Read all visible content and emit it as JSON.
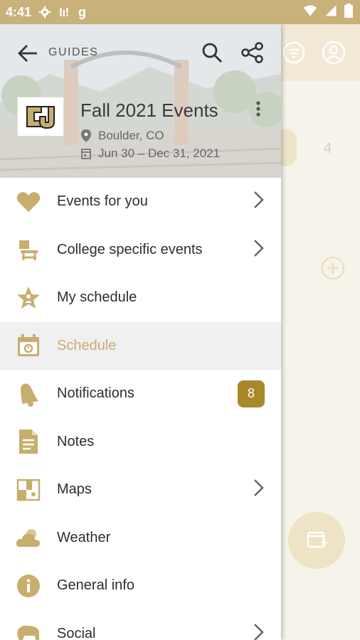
{
  "status_bar": {
    "time": "4:41",
    "g_label": "g"
  },
  "drawer": {
    "nav_label": "GUIDES",
    "guide_title": "Fall 2021 Events",
    "location": "Boulder, CO",
    "dates": "Jun 30 – Dec 31, 2021"
  },
  "menu": {
    "items": [
      {
        "label": "Events for you",
        "icon": "heart-icon",
        "chevron": true
      },
      {
        "label": "College specific events",
        "icon": "school-desk-icon",
        "chevron": true
      },
      {
        "label": "My schedule",
        "icon": "star-person-icon",
        "chevron": false
      },
      {
        "label": "Schedule",
        "icon": "calendar-icon",
        "chevron": false,
        "active": true
      },
      {
        "label": "Notifications",
        "icon": "bell-icon",
        "chevron": false,
        "badge": "8"
      },
      {
        "label": "Notes",
        "icon": "document-icon",
        "chevron": false
      },
      {
        "label": "Maps",
        "icon": "map-icon",
        "chevron": true
      },
      {
        "label": "Weather",
        "icon": "cloud-sun-icon",
        "chevron": false
      },
      {
        "label": "General info",
        "icon": "info-icon",
        "chevron": false
      },
      {
        "label": "Social",
        "icon": "bison-icon",
        "chevron": true
      }
    ]
  },
  "background": {
    "day_number": "4"
  },
  "colors": {
    "gold": "#c8ae6e",
    "badge": "#a88828",
    "status_bar": "#c8b27a"
  }
}
